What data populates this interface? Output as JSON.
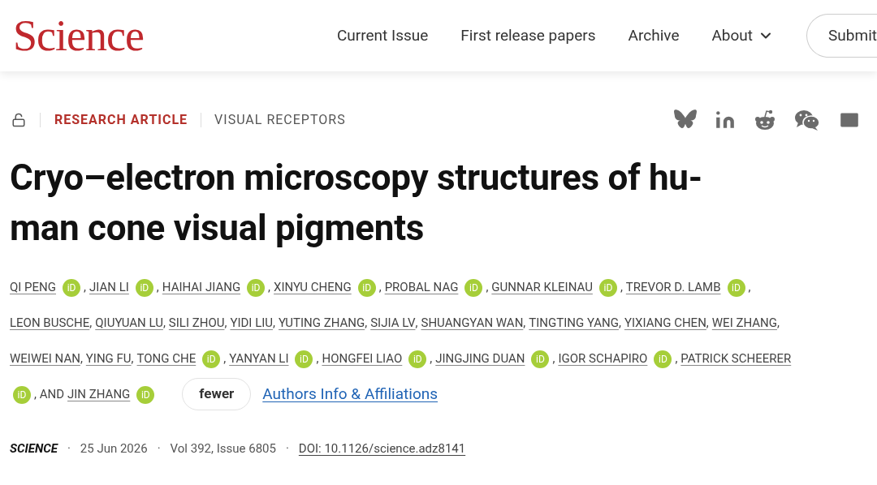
{
  "header": {
    "logo": "Science",
    "nav": [
      {
        "label": "Current Issue",
        "kind": "link"
      },
      {
        "label": "First release papers",
        "kind": "link"
      },
      {
        "label": "Archive",
        "kind": "link"
      },
      {
        "label": "About",
        "kind": "menu"
      },
      {
        "label": "Submit",
        "kind": "button"
      }
    ]
  },
  "article": {
    "type": "RESEARCH ARTICLE",
    "section": "VISUAL RECEPTORS",
    "title_lines": [
      "Cryo–electron microscopy structures of hu-",
      "man cone visual pigments"
    ],
    "author_lines": [
      [
        {
          "name": "QI PENG",
          "orcid": "iD",
          "separator": ","
        },
        {
          "name": "JIAN LI",
          "orcid": "iD",
          "separator": ","
        },
        {
          "name": "HAIHAI JIANG",
          "orcid": "iD",
          "separator": ","
        },
        {
          "name": "XINYU CHENG",
          "orcid": "iD",
          "separator": ","
        },
        {
          "name": "PROBAL NAG",
          "orcid": "iD",
          "separator": ","
        },
        {
          "name": "GUNNAR KLEINAU",
          "orcid": "iD",
          "separator": ","
        },
        {
          "name": "TREVOR D. LAMB",
          "orcid": "iD",
          "separator": ","
        }
      ],
      [
        {
          "name": "LEON BUSCHE",
          "separator": ","
        },
        {
          "name": "QIUYUAN LU",
          "separator": ","
        },
        {
          "name": "SILI ZHOU",
          "separator": ","
        },
        {
          "name": "YIDI LIU",
          "separator": ","
        },
        {
          "name": "YUTING ZHANG",
          "separator": ","
        },
        {
          "name": "SIJIA LV",
          "separator": ","
        },
        {
          "name": "SHUANGYAN WAN",
          "separator": ","
        },
        {
          "name": "TINGTING YANG",
          "separator": ","
        },
        {
          "name": "YIXIANG CHEN",
          "separator": ","
        },
        {
          "name": "WEI ZHANG",
          "separator": ","
        }
      ],
      [
        {
          "name": "WEIWEI NAN",
          "separator": ","
        },
        {
          "name": "YING FU",
          "separator": ","
        },
        {
          "name": "TONG CHE",
          "orcid": "iD",
          "separator": ","
        },
        {
          "name": "YANYAN LI",
          "orcid": "iD",
          "separator": ","
        },
        {
          "name": "HONGFEI LIAO",
          "orcid": "iD",
          "separator": ","
        },
        {
          "name": "JINGJING DUAN",
          "orcid": "iD",
          "separator": ","
        },
        {
          "name": "IGOR SCHAPIRO",
          "orcid": "iD",
          "separator": ","
        },
        {
          "name": "PATRICK SCHEERER"
        }
      ],
      [
        {
          "orcid": "iD",
          "separator": ", AND"
        },
        {
          "name": "JIN ZHANG",
          "orcid": "iD"
        }
      ]
    ],
    "fewer_button": "fewer",
    "affiliations_link": "Authors Info & Affiliations",
    "meta": [
      {
        "kind": "journal",
        "text": "SCIENCE"
      },
      {
        "kind": "dot",
        "text": "·"
      },
      {
        "kind": "text",
        "text": "25 Jun 2026"
      },
      {
        "kind": "dot",
        "text": "·"
      },
      {
        "kind": "text",
        "text": "Vol 392, Issue 6805"
      },
      {
        "kind": "dot",
        "text": "·"
      },
      {
        "kind": "link",
        "text": "DOI: 10.1126/science.adz8141"
      }
    ]
  }
}
